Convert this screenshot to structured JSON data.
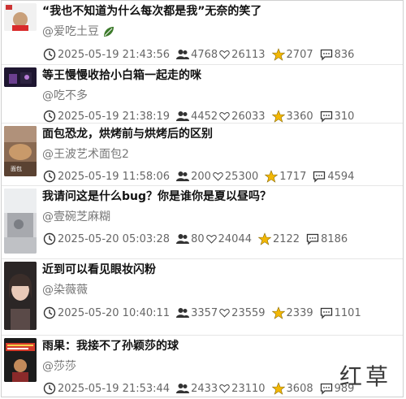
{
  "items": [
    {
      "title": "“我也不知道为什么每次都是我”无奈的笑了",
      "author": "@爱吃土豆",
      "author_icon": "leaf-icon",
      "time": "2025-05-19 21:43:56",
      "viewers": "4768",
      "likes": "26113",
      "stars": "2707",
      "comments": "836"
    },
    {
      "title": "等王慢慢收拾小白箱一起走的咪",
      "author": "@吃不多",
      "time": "2025-05-19 21:38:19",
      "viewers": "4452",
      "likes": "26033",
      "stars": "3360",
      "comments": "310"
    },
    {
      "title": "面包恐龙，烘烤前与烘烤后的区别",
      "author": "@王波艺术面包2",
      "thumb_caption": "面包",
      "time": "2025-05-19 11:58:06",
      "viewers": "200",
      "likes": "25300",
      "stars": "1717",
      "comments": "4594"
    },
    {
      "title": "我请问这是什么bug？你是谁你是夏以昼吗？",
      "author": "@壹碗芝麻糊",
      "time": "2025-05-20 05:03:28",
      "viewers": "80",
      "likes": "24044",
      "stars": "2122",
      "comments": "8186"
    },
    {
      "title": "近到可以看见眼妆闪粉",
      "author": "@染薇薇",
      "time": "2025-05-20 10:40:11",
      "viewers": "3357",
      "likes": "23559",
      "stars": "2339",
      "comments": "1101"
    },
    {
      "title": "雨果：我接不了孙颖莎的球",
      "author": "@莎莎",
      "time": "2025-05-19 21:53:44",
      "viewers": "2433",
      "likes": "23110",
      "stars": "3608",
      "comments": "989"
    }
  ],
  "watermark": "红草",
  "colors": {
    "star": "#f2b705",
    "title": "#111111",
    "meta": "#666666",
    "leaf": "#3c7a2a"
  }
}
